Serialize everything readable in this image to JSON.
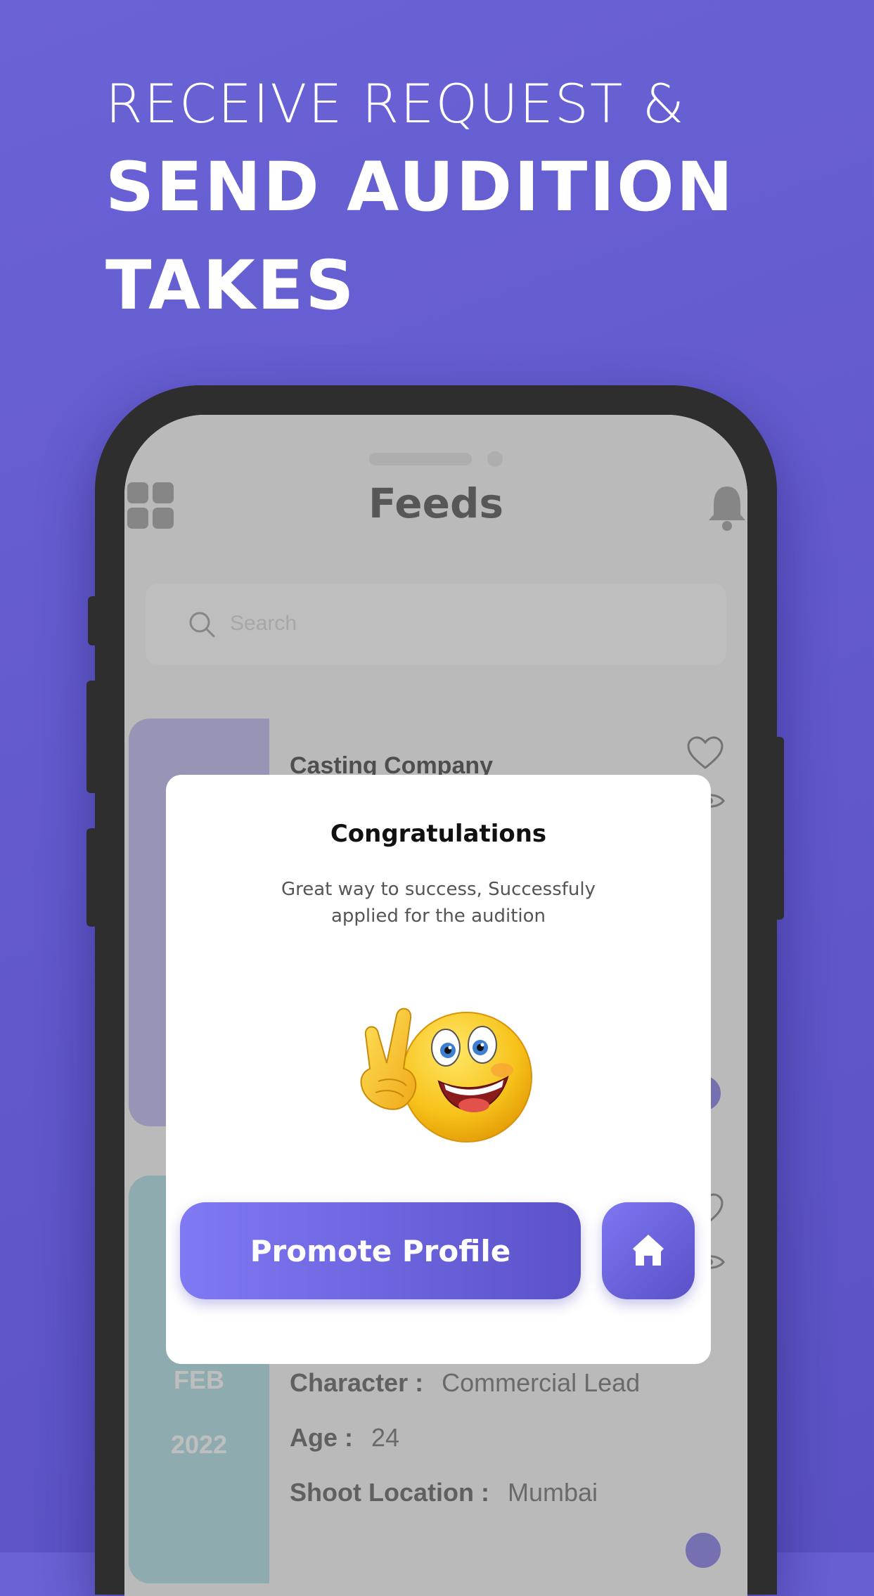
{
  "headline": {
    "line1": "RECEIVE REQUEST &",
    "line2": "SEND AUDITION",
    "line3": "TAKES"
  },
  "app": {
    "title": "Feeds",
    "search_placeholder": "Search",
    "cards": [
      {
        "company": "Casting Company"
      },
      {
        "month": "FEB",
        "year": "2022",
        "details": [
          {
            "label": "Character :",
            "value": "Commercial Lead"
          },
          {
            "label": "Age :",
            "value": "24"
          },
          {
            "label": "Shoot Location :",
            "value": "Mumbai"
          }
        ]
      }
    ]
  },
  "dialog": {
    "title": "Congratulations",
    "message": "Great way to success, Successfuly applied for the audition",
    "promote_label": "Promote Profile"
  },
  "icons": {
    "menu": "grid-menu-icon",
    "notifications": "bell-icon",
    "search": "search-icon",
    "favorite": "heart-icon",
    "views": "eye-icon",
    "home": "home-icon",
    "emoji": "peace-sign-smiley-emoji"
  },
  "colors": {
    "background": "#6058cc",
    "accent": "#7b74e8",
    "phone_frame": "#2e2e2e"
  }
}
